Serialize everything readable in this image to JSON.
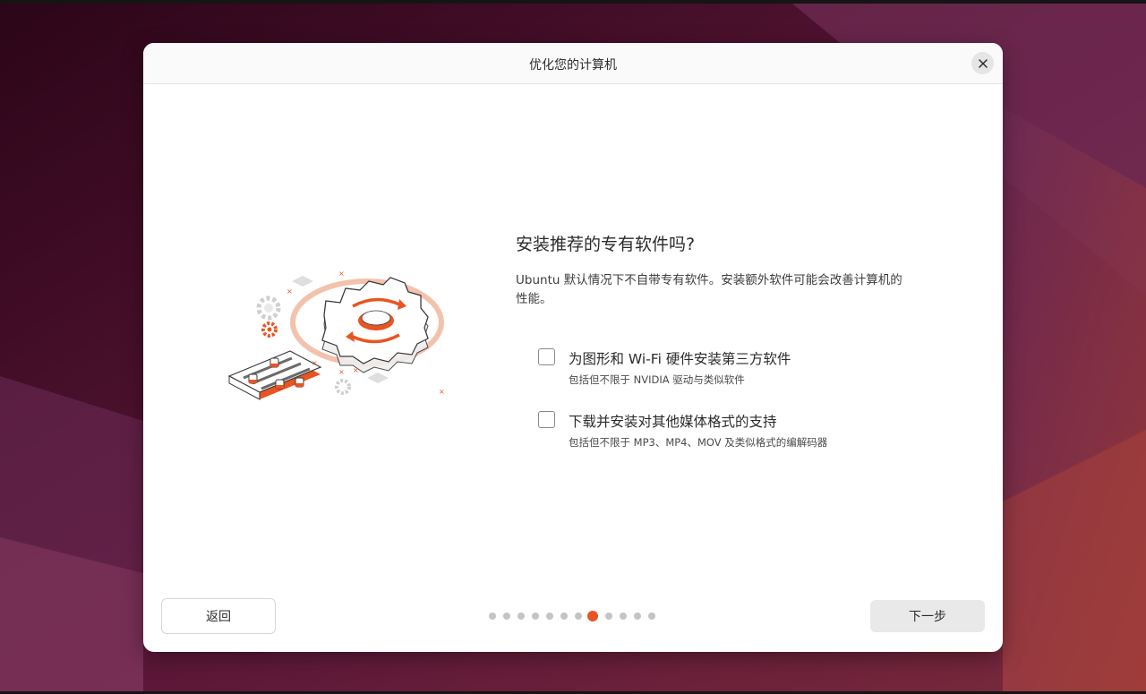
{
  "dialog": {
    "title": "优化您的计算机",
    "close_icon": "close-icon"
  },
  "main": {
    "question": "安装推荐的专有软件吗?",
    "description": "Ubuntu 默认情况下不自带专有软件。安装额外软件可能会改善计算机的性能。",
    "options": [
      {
        "label": "为图形和 Wi-Fi 硬件安装第三方软件",
        "sublabel": "包括但不限于 NVIDIA 驱动与类似软件",
        "checked": false
      },
      {
        "label": "下载并安装对其他媒体格式的支持",
        "sublabel": "包括但不限于 MP3、MP4、MOV 及类似格式的编解码器",
        "checked": false
      }
    ]
  },
  "footer": {
    "back_label": "返回",
    "next_label": "下一步",
    "progress": {
      "total_steps": 12,
      "current_step": 8
    }
  },
  "colors": {
    "accent": "#e95420",
    "dialog_bg": "#ffffff",
    "button_bg": "#e9e9e9"
  }
}
